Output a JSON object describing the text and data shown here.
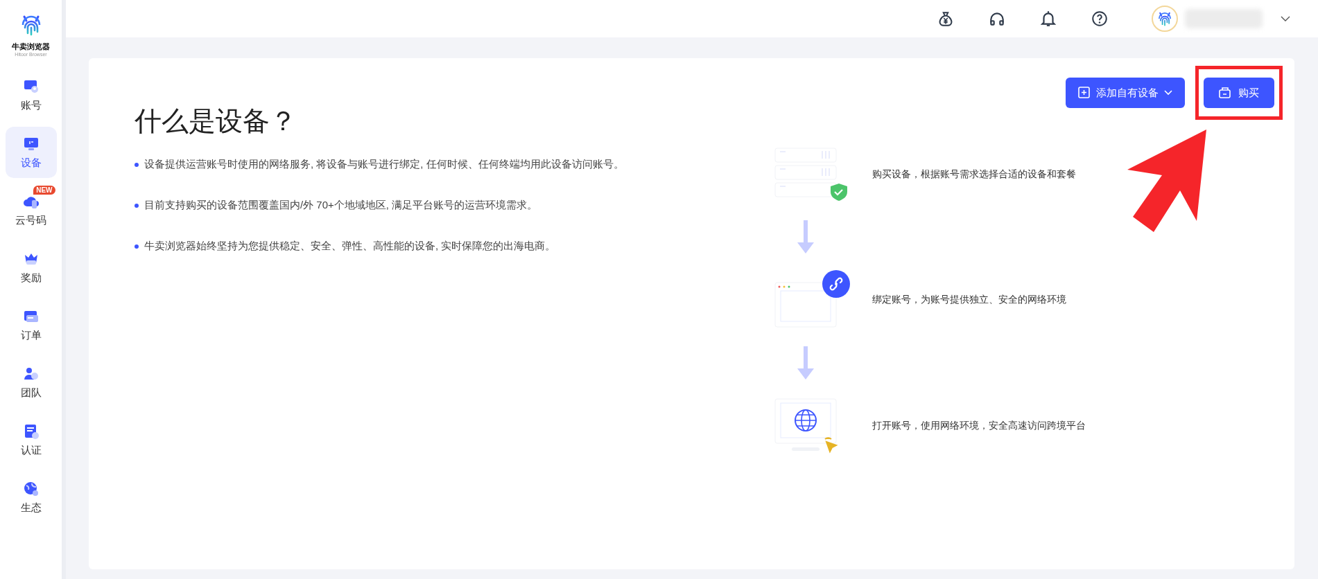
{
  "brand": {
    "name": "牛卖浏览器",
    "subtitle": "Hitoor Browser"
  },
  "nav": [
    {
      "label": "账号",
      "selected": false
    },
    {
      "label": "设备",
      "selected": true
    },
    {
      "label": "云号码",
      "selected": false,
      "badge": "NEW"
    },
    {
      "label": "奖励",
      "selected": false
    },
    {
      "label": "订单",
      "selected": false
    },
    {
      "label": "团队",
      "selected": false
    },
    {
      "label": "认证",
      "selected": false
    },
    {
      "label": "生态",
      "selected": false
    }
  ],
  "actions": [
    {
      "label": "添加自有设备",
      "kind": "dropdown"
    },
    {
      "label": "购买",
      "kind": "buy"
    }
  ],
  "intro": {
    "title": "什么是设备？",
    "points": [
      "设备提供运营账号时使用的网络服务, 将设备与账号进行绑定, 任何时候、任何终端均用此设备访问账号。",
      "目前支持购买的设备范围覆盖国内/外 70+个地域地区, 满足平台账号的运营环境需求。",
      "牛卖浏览器始终坚持为您提供稳定、安全、弹性、高性能的设备, 实时保障您的出海电商。"
    ]
  },
  "steps": [
    {
      "kind": "server",
      "text": "购买设备，根据账号需求选择合适的设备和套餐"
    },
    {
      "kind": "link",
      "text": "绑定账号，为账号提供独立、安全的网络环境"
    },
    {
      "kind": "globe",
      "text": "打开账号，使用网络环境，安全高速访问跨境平台"
    }
  ]
}
